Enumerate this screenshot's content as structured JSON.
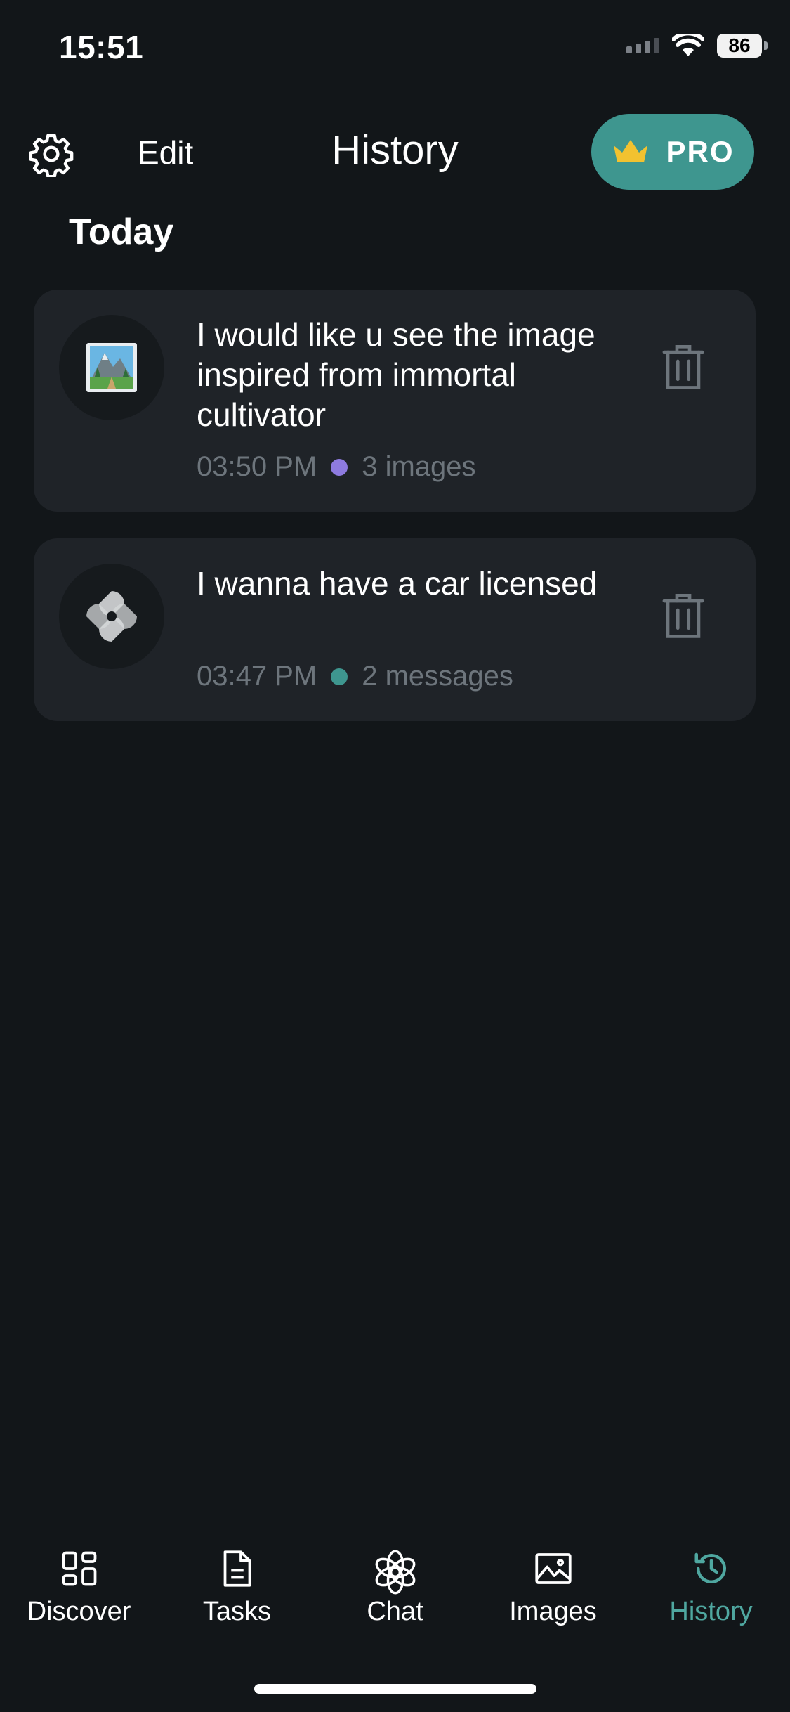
{
  "status_bar": {
    "time": "15:51",
    "battery": "86"
  },
  "header": {
    "edit_label": "Edit",
    "title": "History",
    "pro_label": "PRO"
  },
  "section_title": "Today",
  "items": [
    {
      "text": "I would like u see the image inspired from immortal cultivator",
      "time": "03:50 PM",
      "count": "3 images",
      "icon": "image-thumbnail-icon",
      "dot_color": "#8e7be0"
    },
    {
      "text": "I wanna have a car licensed",
      "time": "03:47 PM",
      "count": "2 messages",
      "icon": "chat-logo-icon",
      "dot_color": "#3e968f"
    }
  ],
  "tabs": [
    {
      "label": "Discover",
      "icon": "grid-icon"
    },
    {
      "label": "Tasks",
      "icon": "document-icon"
    },
    {
      "label": "Chat",
      "icon": "chat-logo-icon"
    },
    {
      "label": "Images",
      "icon": "image-icon"
    },
    {
      "label": "History",
      "icon": "history-icon",
      "active": true
    }
  ],
  "colors": {
    "background": "#121619",
    "card": "#1f2328",
    "accent": "#3e968f",
    "muted": "#6d757c"
  }
}
